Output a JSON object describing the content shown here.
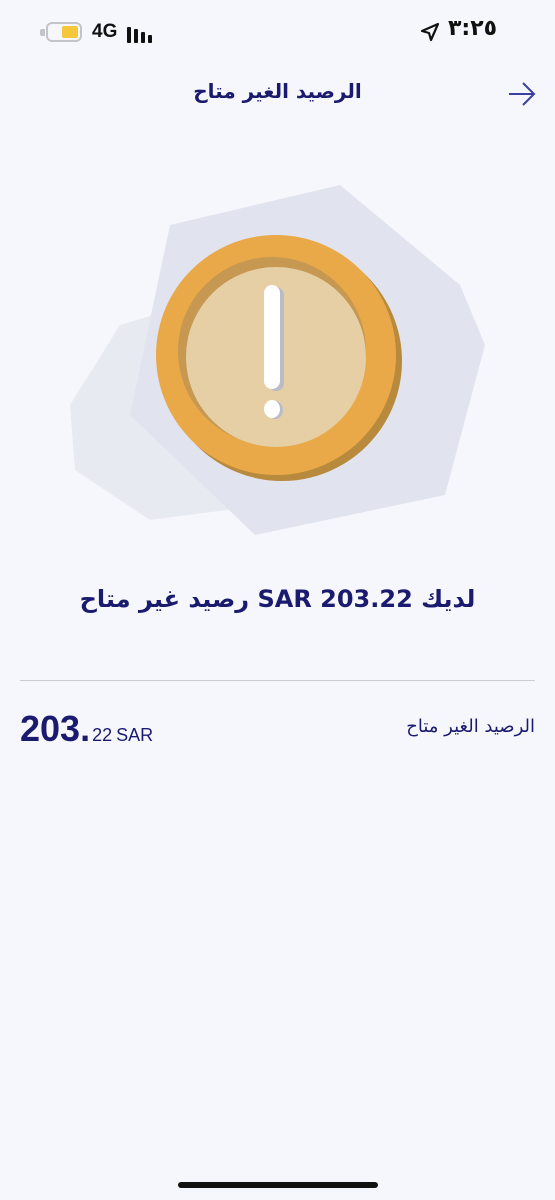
{
  "status_bar": {
    "time": "٣:٢٥",
    "network": "4G",
    "battery_color": "#f5c83b",
    "icons": [
      "battery-icon",
      "signal-icon",
      "location-arrow-icon"
    ]
  },
  "header": {
    "title": "الرصيد الغير متاح",
    "back_icon": "arrow-right-icon"
  },
  "illustration": {
    "icon": "warning-coin-icon",
    "coin_color": "#eaa948",
    "coin_inner_color": "#e6cfa5"
  },
  "message": "لديك SAR 203.22 رصيد غير متاح",
  "balance": {
    "label": "الرصيد الغير متاح",
    "amount_integer": "203",
    "amount_separator": ".",
    "amount_fraction": "22",
    "currency": "SAR"
  },
  "colors": {
    "text_primary": "#1a1b6e",
    "background": "#f6f7fc"
  }
}
